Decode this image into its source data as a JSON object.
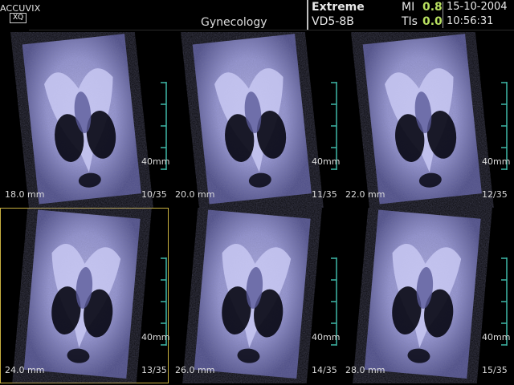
{
  "header": {
    "brand": "ACCUVIX",
    "brand_sub": "XQ",
    "preset": "Gynecology",
    "mode": "Extreme",
    "probe": "VD5-8B",
    "mi_label": "MI",
    "mi_value": "0.8",
    "tis_label": "TIs",
    "tis_value": "0.0",
    "date": "15-10-2004",
    "time": "10:56:31"
  },
  "colors": {
    "tissue": "#9a9ad8",
    "dark": "#070712",
    "accent": "#b8e060",
    "scale": "#3fb8a8",
    "selected_outline": "#c8b040"
  },
  "panels": [
    {
      "depth": "18.0 mm",
      "frame": "10/35",
      "ruler": "40mm",
      "selected": false
    },
    {
      "depth": "20.0 mm",
      "frame": "11/35",
      "ruler": "40mm",
      "selected": false
    },
    {
      "depth": "22.0 mm",
      "frame": "12/35",
      "ruler": "40mm",
      "selected": false
    },
    {
      "depth": "24.0 mm",
      "frame": "13/35",
      "ruler": "40mm",
      "selected": true
    },
    {
      "depth": "26.0 mm",
      "frame": "14/35",
      "ruler": "40mm",
      "selected": false
    },
    {
      "depth": "28.0 mm",
      "frame": "15/35",
      "ruler": "40mm",
      "selected": false
    }
  ]
}
